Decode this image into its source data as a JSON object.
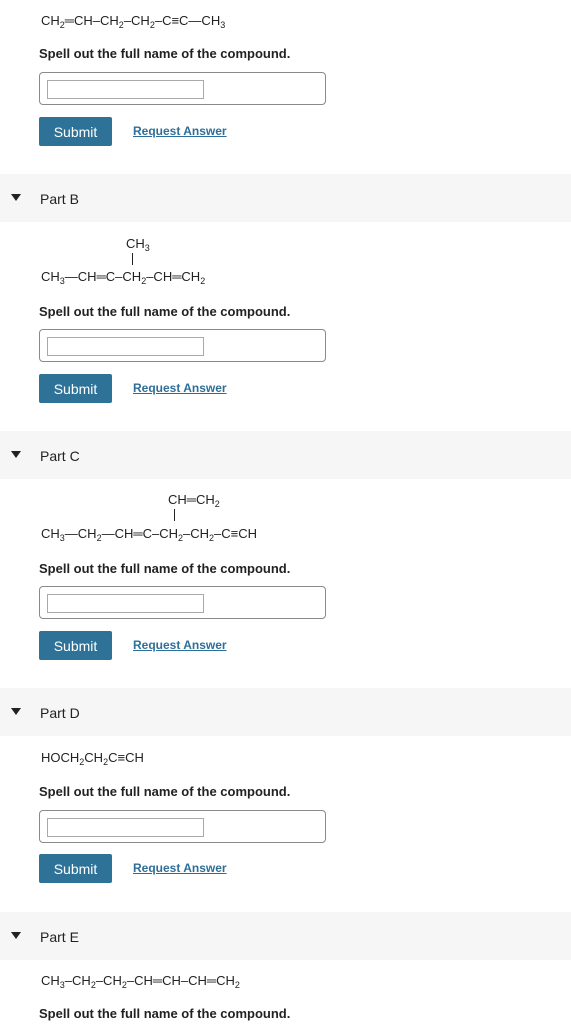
{
  "part_a": {
    "formula": [
      [
        "CH",
        "2"
      ],
      [
        "═CH–CH",
        "2"
      ],
      [
        "–CH",
        "2"
      ],
      [
        "–C≡C—CH",
        "3"
      ]
    ],
    "prompt": "Spell out the full name of the compound.",
    "submit": "Submit",
    "request": "Request Answer"
  },
  "part_b": {
    "title": "Part B",
    "substituent": [
      [
        "CH",
        "3"
      ]
    ],
    "formula": [
      [
        "CH",
        "3"
      ],
      [
        "—CH═C–CH",
        "2"
      ],
      [
        "–CH═CH",
        "2"
      ]
    ],
    "prompt": "Spell out the full name of the compound.",
    "submit": "Submit",
    "request": "Request Answer"
  },
  "part_c": {
    "title": "Part C",
    "substituent": [
      [
        "CH═CH",
        "2"
      ]
    ],
    "formula": [
      [
        "CH",
        "3"
      ],
      [
        "—CH",
        "2"
      ],
      [
        "—CH═C–CH",
        "2"
      ],
      [
        "–CH",
        "2"
      ],
      [
        "–C≡CH",
        ""
      ]
    ],
    "prompt": "Spell out the full name of the compound.",
    "submit": "Submit",
    "request": "Request Answer"
  },
  "part_d": {
    "title": "Part D",
    "formula": [
      [
        "HOCH",
        "2"
      ],
      [
        "CH",
        "2"
      ],
      [
        "C≡CH",
        ""
      ]
    ],
    "prompt": "Spell out the full name of the compound.",
    "submit": "Submit",
    "request": "Request Answer"
  },
  "part_e": {
    "title": "Part E",
    "formula": [
      [
        "CH",
        "3"
      ],
      [
        "–CH",
        "2"
      ],
      [
        "–CH",
        "2"
      ],
      [
        "–CH═CH–CH═CH",
        "2"
      ]
    ],
    "prompt": "Spell out the full name of the compound."
  }
}
